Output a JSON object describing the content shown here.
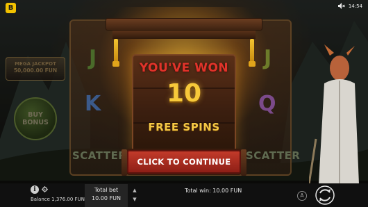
{
  "top_bar": {
    "logo_letter": "B",
    "sound_icon": "speaker-muted-icon",
    "clock": "14:54"
  },
  "jackpot": {
    "label": "MEGA JACKPOT",
    "value": "50,000.00 FUN"
  },
  "buy_bonus": {
    "line1": "BUY",
    "line2": "BONUS"
  },
  "reels": {
    "symbols": [
      "J",
      "K",
      "J",
      "Q"
    ],
    "scatter_label": "SCATTER"
  },
  "popup": {
    "title": "YOU'VE WON",
    "count": "10",
    "subtitle": "FREE SPINS",
    "button_label": "CLICK TO CONTINUE"
  },
  "bottom_bar": {
    "balance": "Balance 1,376.00 FUN",
    "total_bet_label": "Total bet",
    "total_bet_value": "10.00 FUN",
    "total_win": "Total win: 10.00 FUN",
    "auto_label": "A"
  },
  "colors": {
    "title_red": "#e0342a",
    "gold": "#f7c93a",
    "button_red": "#c23a2a",
    "logo_yellow": "#f2c200"
  }
}
